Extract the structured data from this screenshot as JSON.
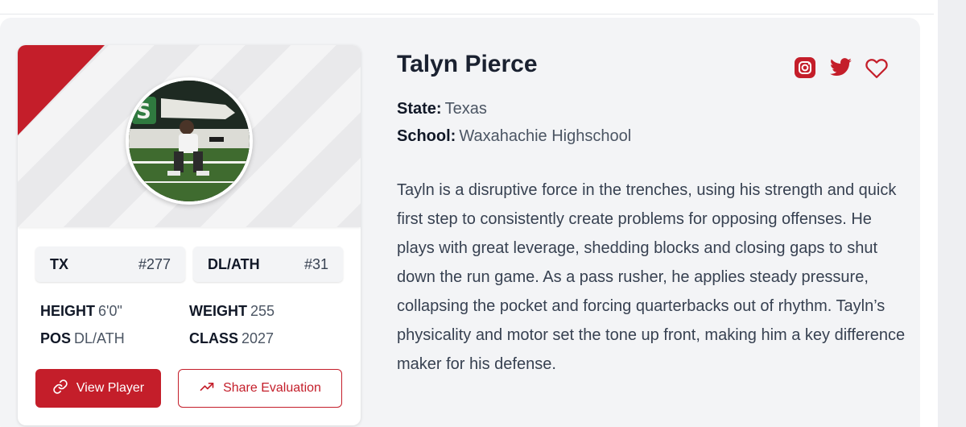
{
  "player": {
    "name": "Talyn Pierce",
    "state_label": "State:",
    "state": "Texas",
    "school_label": "School:",
    "school": "Waxahachie Highschool",
    "bio": "Tayln is a disruptive force in the trenches, using his strength and quick first step to consistently create problems for opposing offenses. He plays with great leverage, shedding blocks and closing gaps to shut down the run game. As a pass rusher, he applies steady pressure, collapsing the pocket and forcing quarterbacks out of rhythm. Tayln’s physicality and motor set the tone up front, making him a key difference maker for his defense."
  },
  "card": {
    "state_rank": {
      "label": "TX",
      "value": "#277"
    },
    "position_rank": {
      "label": "DL/ATH",
      "value": "#31"
    },
    "attributes": {
      "height_label": "HEIGHT",
      "height": "6'0\"",
      "weight_label": "WEIGHT",
      "weight": "255",
      "pos_label": "POS",
      "pos": "DL/ATH",
      "class_label": "CLASS",
      "class": "2027"
    },
    "buttons": {
      "view_player": "View Player",
      "share_evaluation": "Share Evaluation"
    }
  },
  "icons": {
    "social": [
      "instagram-icon",
      "twitter-icon",
      "heart-icon"
    ],
    "view": "link-icon",
    "share": "trending-up-icon"
  },
  "colors": {
    "accent": "#c41e2a",
    "panel": "#f3f4f6",
    "text": "#1a2130"
  }
}
